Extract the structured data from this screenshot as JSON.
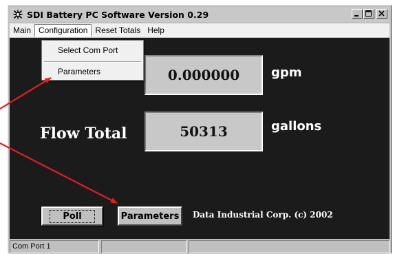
{
  "window": {
    "title": "SDI Battery PC Software Version 0.29",
    "controls": [
      "minimize",
      "maximize",
      "close"
    ]
  },
  "menubar": {
    "items": [
      "Main",
      "Configuration",
      "Reset Totals",
      "Help"
    ]
  },
  "configuration_menu": {
    "items": [
      "Select Com Port",
      "Parameters"
    ]
  },
  "flow_rate": {
    "value": "0.000000",
    "unit": "gpm"
  },
  "flow_total": {
    "label": "Flow Total",
    "value": "50313",
    "unit": "gallons"
  },
  "buttons": {
    "poll": "Poll",
    "parameters": "Parameters"
  },
  "copyright": "Data Industrial Corp. (c) 2002",
  "statusbar": {
    "panels": [
      "Com Port 1",
      "",
      ""
    ]
  },
  "colors": {
    "client_bg": "#1b1b1b",
    "value_box": "#c8c8c8",
    "arrow": "#e0201c"
  },
  "icons": {
    "app": "sparkle-icon"
  }
}
